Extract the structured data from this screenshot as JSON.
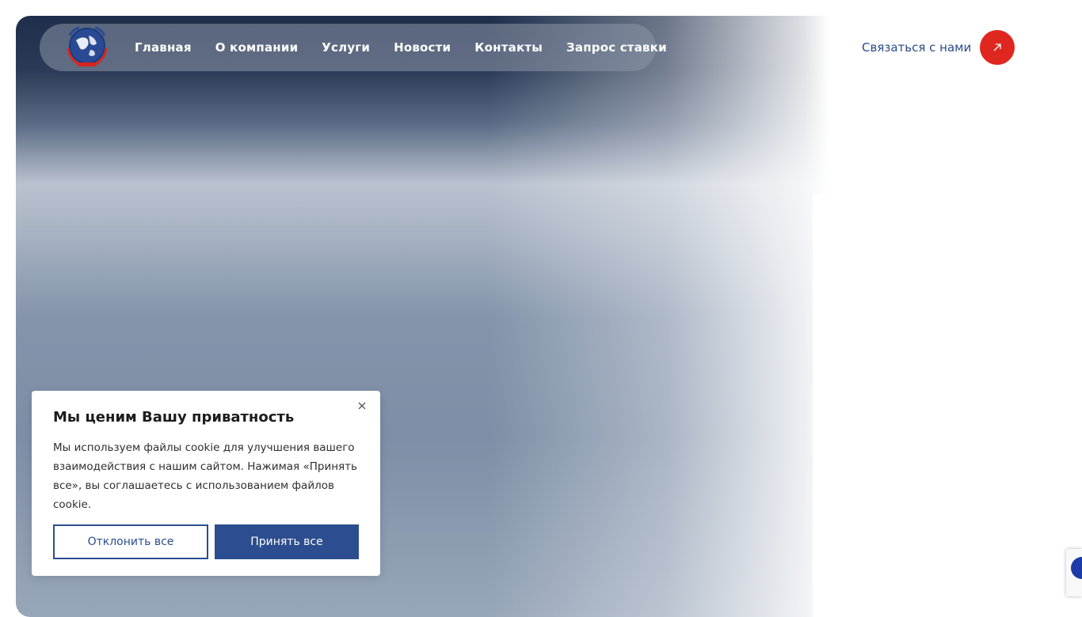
{
  "header": {
    "nav": [
      {
        "label": "Главная"
      },
      {
        "label": "О компании"
      },
      {
        "label": "Услуги"
      },
      {
        "label": "Новости"
      },
      {
        "label": "Контакты"
      },
      {
        "label": "Запрос ставки"
      }
    ],
    "contact_label": "Связаться с нами",
    "contact_icon": "arrow-up-right-icon"
  },
  "cookie": {
    "title": "Мы ценим Вашу приватность",
    "text": "Мы используем файлы cookie для улучшения вашего взаимодействия с нашим сайтом. Нажимая «Принять все», вы соглашаетесь с использованием файлов cookie.",
    "decline_label": "Отклонить все",
    "accept_label": "Принять все",
    "close_icon": "close-icon"
  },
  "colors": {
    "brand_blue": "#2c4d8f",
    "accent_red": "#e0271f",
    "hero_dark": "#1e2e4b"
  }
}
